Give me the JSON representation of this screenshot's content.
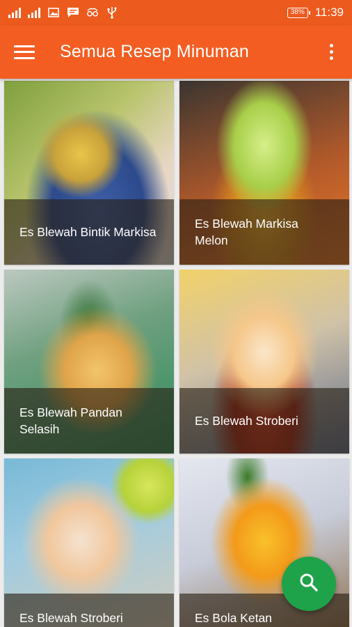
{
  "status_bar": {
    "battery": "38%",
    "time": "11:39",
    "icons": [
      "signal-icon",
      "signal-icon",
      "image-icon",
      "chat-icon",
      "glasses-icon",
      "usb-icon"
    ]
  },
  "app_bar": {
    "title": "Semua Resep Minuman",
    "menu_icon": "hamburger-menu-icon",
    "more_icon": "more-vert-icon"
  },
  "recipes": [
    {
      "title": "Es Blewah Bintik Markisa"
    },
    {
      "title": "Es Blewah Markisa Melon"
    },
    {
      "title": "Es Blewah Pandan Selasih"
    },
    {
      "title": "Es Blewah Stroberi"
    },
    {
      "title": "Es Blewah Stroberi"
    },
    {
      "title": "Es Bola Ketan"
    }
  ],
  "fab": {
    "icon": "search-icon",
    "color": "#1fa34a"
  },
  "colors": {
    "status_bar": "#ec5a1e",
    "app_bar": "#f35d22"
  }
}
